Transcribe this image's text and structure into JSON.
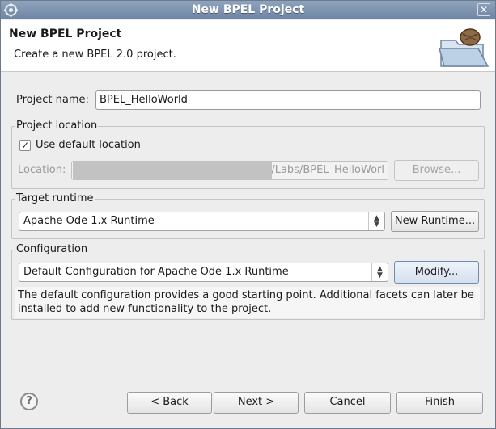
{
  "window": {
    "title": "New BPEL Project",
    "close_glyph": "✕"
  },
  "header": {
    "title": "New BPEL Project",
    "description": "Create a new BPEL 2.0 project.",
    "icon": "open-folder-with-bean-icon"
  },
  "project_name": {
    "label": "Project name:",
    "value": "BPEL_HelloWorld"
  },
  "project_location": {
    "group_label": "Project location",
    "use_default_label": "Use default location",
    "use_default_checked": true,
    "location_label": "Location:",
    "location_value": "/Labs/BPEL_HelloWorl",
    "browse_label": "Browse..."
  },
  "target_runtime": {
    "group_label": "Target runtime",
    "selected": "Apache Ode 1.x Runtime",
    "new_runtime_label": "New Runtime..."
  },
  "configuration": {
    "group_label": "Configuration",
    "selected": "Default Configuration for Apache Ode 1.x Runtime",
    "modify_label": "Modify...",
    "info_text": "The default configuration provides a good starting point. Additional facets can later be installed to add new functionality to the project."
  },
  "footer": {
    "help_glyph": "?",
    "back_label": "< Back",
    "next_label": "Next >",
    "cancel_label": "Cancel",
    "finish_label": "Finish"
  },
  "colors": {
    "titlebar": "#7b90ad",
    "dialog_bg": "#ededed",
    "header_bg": "#ffffff",
    "focus_border": "#6f8db3"
  }
}
